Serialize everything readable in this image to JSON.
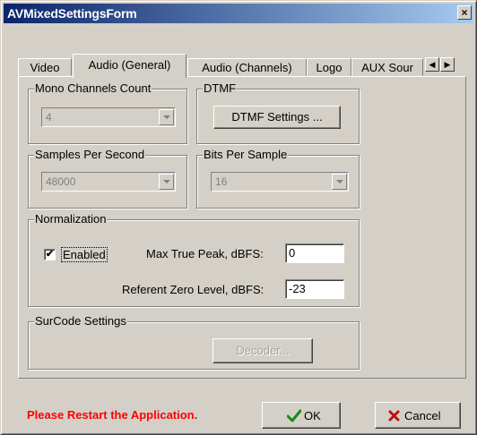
{
  "window": {
    "title": "AVMixedSettingsForm",
    "close_glyph": "×"
  },
  "tabs": [
    {
      "label": "Video"
    },
    {
      "label": "Audio (General)",
      "active": true
    },
    {
      "label": "Audio (Channels)"
    },
    {
      "label": "Logo"
    },
    {
      "label": "AUX Sour"
    }
  ],
  "tab_scroll": {
    "left": "◀",
    "right": "▶"
  },
  "groups": {
    "mono_channels": {
      "label": "Mono Channels Count",
      "value": "4"
    },
    "dtmf": {
      "label": "DTMF",
      "button": "DTMF Settings ..."
    },
    "samples_per_second": {
      "label": "Samples Per Second",
      "value": "48000"
    },
    "bits_per_sample": {
      "label": "Bits Per Sample",
      "value": "16"
    },
    "normalization": {
      "label": "Normalization",
      "enabled_label": "Enabled",
      "enabled_checked": true,
      "check_glyph": "✔",
      "max_true_peak_label": "Max True Peak, dBFS:",
      "max_true_peak_value": "0",
      "referent_zero_label": "Referent Zero Level, dBFS:",
      "referent_zero_value": "-23"
    },
    "surcode": {
      "label": "SurCode Settings",
      "button": "Decoder..."
    }
  },
  "footer": {
    "warning": "Please Restart the Application.",
    "warning_color": "#ff0000",
    "ok_label": "OK",
    "ok_icon": "check-icon",
    "cancel_label": "Cancel",
    "cancel_icon": "x-icon"
  }
}
